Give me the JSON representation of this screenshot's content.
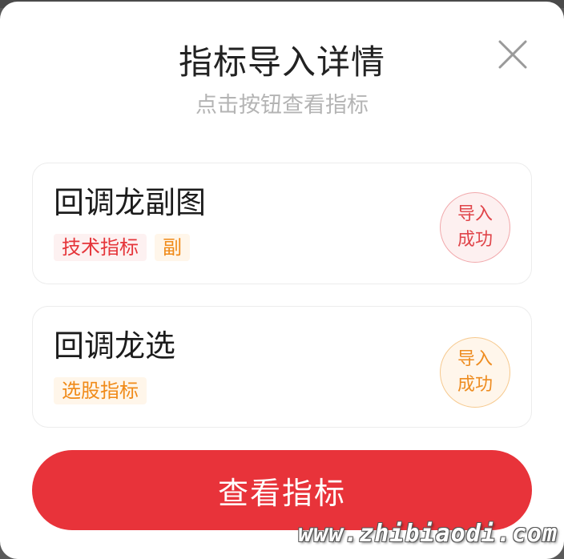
{
  "dialog": {
    "title": "指标导入详情",
    "subtitle": "点击按钮查看指标",
    "close_icon": "close-icon"
  },
  "indicators": [
    {
      "name": "回调龙副图",
      "tags": [
        "技术指标",
        "副"
      ],
      "status_line1": "导入",
      "status_line2": "成功",
      "status_color": "#e0454a"
    },
    {
      "name": "回调龙选",
      "tags": [
        "选股指标"
      ],
      "status_line1": "导入",
      "status_line2": "成功",
      "status_color": "#ee8c20"
    }
  ],
  "primary_button": {
    "label": "查看指标",
    "color": "#e8333a"
  },
  "watermark": "www.zhibiaodi.com"
}
